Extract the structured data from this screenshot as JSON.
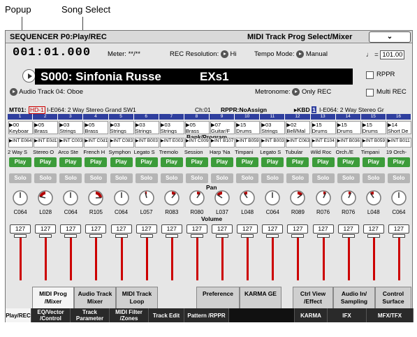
{
  "callouts": {
    "popup": "Popup",
    "song_select": "Song Select"
  },
  "title": {
    "left": "SEQUENCER P0:Play/REC",
    "right": "MIDI Track Prog Select/Mixer"
  },
  "locator": "001:01.000",
  "meter_label": "Meter:",
  "meter_value": "**/**",
  "rec_res_label": "REC Resolution:",
  "rec_res_value": "Hi",
  "tempo_mode_label": "Tempo Mode:",
  "tempo_mode_value": "Manual",
  "tempo_value": "101.00",
  "song": {
    "name": "S000: Sinfonia Russe",
    "category": "EXs1"
  },
  "rppr_label": "RPPR",
  "audio_track": "Audio Track 04: Oboe",
  "metronome_label": "Metronome:",
  "metronome_value": "Only REC",
  "multi_rec_label": "Multi REC",
  "info_left": "MT01:",
  "info_hd": "HD-1",
  "info_prog": "I-E064: 2 Way Stereo Grand SW1",
  "info_ch": "Ch:01",
  "info_rppr": "RPPR:NoAssign",
  "info_kbd": "KBD",
  "info_kbd_num": "1",
  "info_right": "I-E064: 2 Way Stereo Gr",
  "bank_label": "Bank/Program",
  "pan_label": "Pan",
  "volume_label": "Volume",
  "tracks": [
    {
      "num": "1",
      "cat": "00",
      "catn": "Keyboar",
      "bank": "INT E064",
      "name": "2 Way S",
      "pan": "C064",
      "pan_val": 64,
      "vol": "127"
    },
    {
      "num": "2",
      "cat": "05",
      "catn": "Brass",
      "bank": "INT E0d1",
      "name": "Stereo O",
      "pan": "L028",
      "pan_val": 28,
      "vol": "127"
    },
    {
      "num": "3",
      "cat": "03",
      "catn": "Strings",
      "bank": "INT C003",
      "name": "Arco Ste",
      "pan": "C064",
      "pan_val": 64,
      "vol": "127"
    },
    {
      "num": "4",
      "cat": "05",
      "catn": "Brass",
      "bank": "INT C0d1",
      "name": "French H",
      "pan": "R105",
      "pan_val": 105,
      "vol": "127"
    },
    {
      "num": "5",
      "cat": "03",
      "catn": "Strings",
      "bank": "INT C083",
      "name": "Symphon",
      "pan": "C064",
      "pan_val": 64,
      "vol": "127"
    },
    {
      "num": "6",
      "cat": "03",
      "catn": "Strings",
      "bank": "INT B003",
      "name": "Legato S",
      "pan": "L057",
      "pan_val": 57,
      "vol": "127"
    },
    {
      "num": "7",
      "cat": "03",
      "catn": "Strings",
      "bank": "INT E003",
      "name": "Tremolo",
      "pan": "R083",
      "pan_val": 83,
      "vol": "127"
    },
    {
      "num": "8",
      "cat": "05",
      "catn": "Brass",
      "bank": "INT C009",
      "name": "Session",
      "pan": "R080",
      "pan_val": 80,
      "vol": "127"
    },
    {
      "num": "9",
      "cat": "07",
      "catn": "Guitar/F",
      "bank": "INT B107",
      "name": "Harp 'Na",
      "pan": "L037",
      "pan_val": 37,
      "vol": "127"
    },
    {
      "num": "10",
      "cat": "15",
      "catn": "Drums",
      "bank": "INT B059",
      "name": "Timpani",
      "pan": "L048",
      "pan_val": 48,
      "vol": "127"
    },
    {
      "num": "11",
      "cat": "03",
      "catn": "Strings",
      "bank": "INT B003",
      "name": "Legato S",
      "pan": "C064",
      "pan_val": 64,
      "vol": "127"
    },
    {
      "num": "12",
      "cat": "02",
      "catn": "Bell/Mal",
      "bank": "INT C063",
      "name": "Tubular",
      "pan": "R089",
      "pan_val": 89,
      "vol": "127"
    },
    {
      "num": "13",
      "cat": "15",
      "catn": "Drums",
      "bank": "INT E104",
      "name": "Wild Roc",
      "pan": "R076",
      "pan_val": 76,
      "vol": "127"
    },
    {
      "num": "14",
      "cat": "15",
      "catn": "Drums",
      "bank": "INT B036",
      "name": "Orch./E",
      "pan": "R076",
      "pan_val": 76,
      "vol": "127"
    },
    {
      "num": "15",
      "cat": "15",
      "catn": "Drums",
      "bank": "INT B059",
      "name": "Timpani",
      "pan": "L048",
      "pan_val": 48,
      "vol": "127"
    },
    {
      "num": "16",
      "cat": "14",
      "catn": "Short De",
      "bank": "INT B011",
      "name": "19 Orch-",
      "pan": "C064",
      "pan_val": 64,
      "vol": "127"
    }
  ],
  "play_label": "Play",
  "solo_label": "Solo",
  "tabs_top": [
    "MIDI Prog /Mixer",
    "Audio Track Mixer",
    "MIDI Track Loop",
    "Preference",
    "KARMA GE",
    "Ctrl View /Effect",
    "Audio In/ Sampling",
    "Control Surface"
  ],
  "tabs_bottom": [
    "Play/REC",
    "EQ/Vector /Control",
    "Track Parameter",
    "MIDI Filter /Zones",
    "Track Edit",
    "Pattern /RPPR",
    "",
    "KARMA",
    "IFX",
    "MFX/TFX"
  ]
}
